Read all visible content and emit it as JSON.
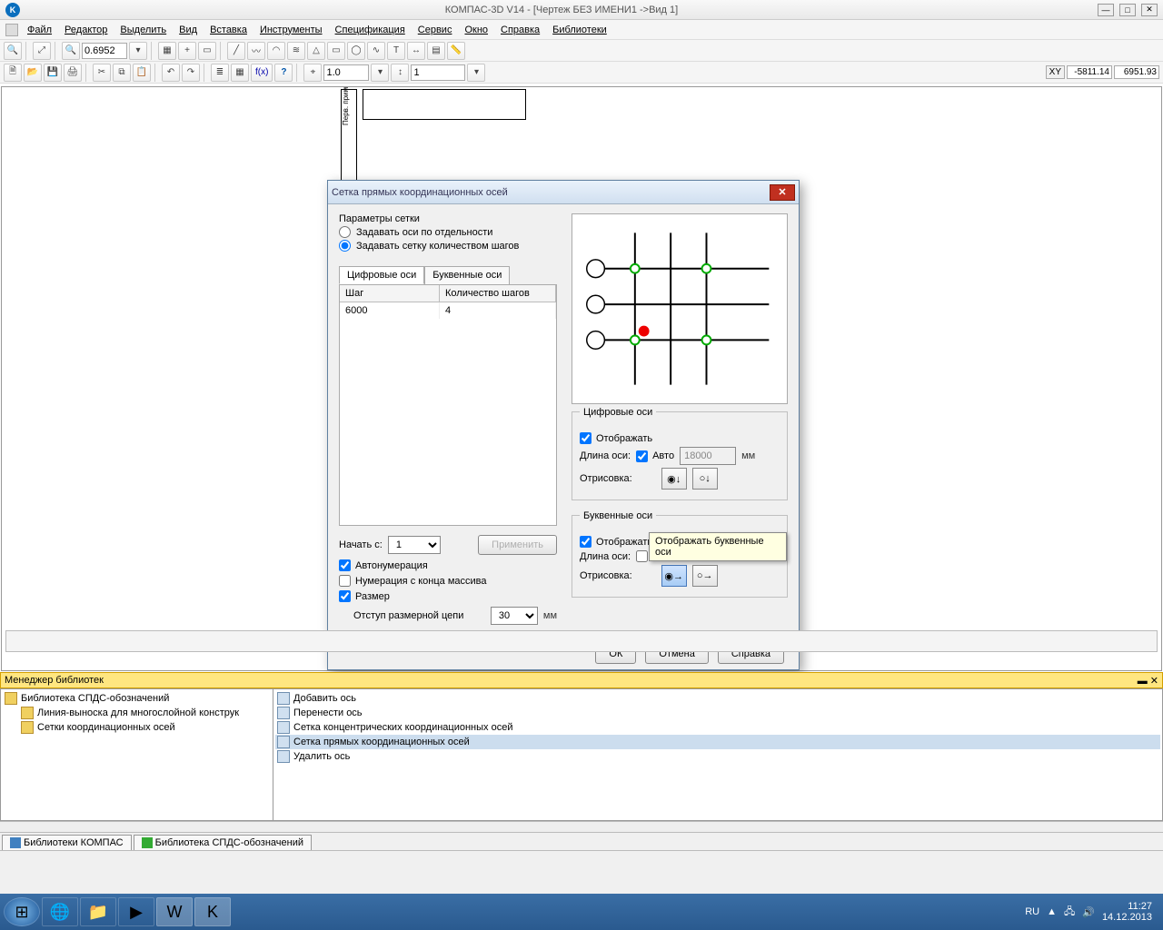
{
  "titlebar": {
    "title": "КОМПАС-3D V14 - [Чертеж БЕЗ ИМЕНИ1 ->Вид 1]"
  },
  "menu": [
    "Файл",
    "Редактор",
    "Выделить",
    "Вид",
    "Вставка",
    "Инструменты",
    "Спецификация",
    "Сервис",
    "Окно",
    "Справка",
    "Библиотеки"
  ],
  "toolbar_zoom": "0.6952",
  "toolbar_val1": "1.0",
  "toolbar_val2": "1",
  "coords": {
    "label": "XY",
    "x": "-5811.14",
    "y": "6951.93"
  },
  "library": {
    "title": "Менеджер библиотек",
    "left_root": "Библиотека СПДС-обозначений",
    "left_items": [
      "Линия-выноска для многослойной конструк",
      "Сетки координационных осей"
    ],
    "right_items": [
      "Добавить ось",
      "Перенести ось",
      "Сетка концентрических координационных осей",
      "Сетка прямых координационных осей",
      "Удалить ось"
    ],
    "tabs": [
      "Библиотеки КОМПАС",
      "Библиотека СПДС-обозначений"
    ]
  },
  "tray": {
    "lang": "RU",
    "time": "11:27",
    "date": "14.12.2013"
  },
  "dialog": {
    "title": "Сетка прямых координационных осей",
    "params_title": "Параметры сетки",
    "radio1": "Задавать оси по отдельности",
    "radio2": "Задавать сетку количеством шагов",
    "tab1": "Цифровые оси",
    "tab2": "Буквенные оси",
    "th1": "Шаг",
    "th2": "Количество шагов",
    "cell1": "6000",
    "cell2": "4",
    "start_lbl": "Начать с:",
    "start_val": "1",
    "apply": "Применить",
    "auto_num": "Автонумерация",
    "num_end": "Нумерация с конца массива",
    "size_chk": "Размер",
    "chain_lbl": "Отступ размерной цепи",
    "chain_val": "30",
    "chain_unit": "мм",
    "digit_group": "Цифровые оси",
    "show": "Отображать",
    "axis_len": "Длина оси:",
    "auto": "Авто",
    "axis_len_val": "18000",
    "mm": "мм",
    "render": "Отрисовка:",
    "letter_group": "Буквенные оси",
    "tooltip": "Отображать буквенные оси",
    "ok": "ОК",
    "cancel": "Отмена",
    "help": "Справка"
  }
}
